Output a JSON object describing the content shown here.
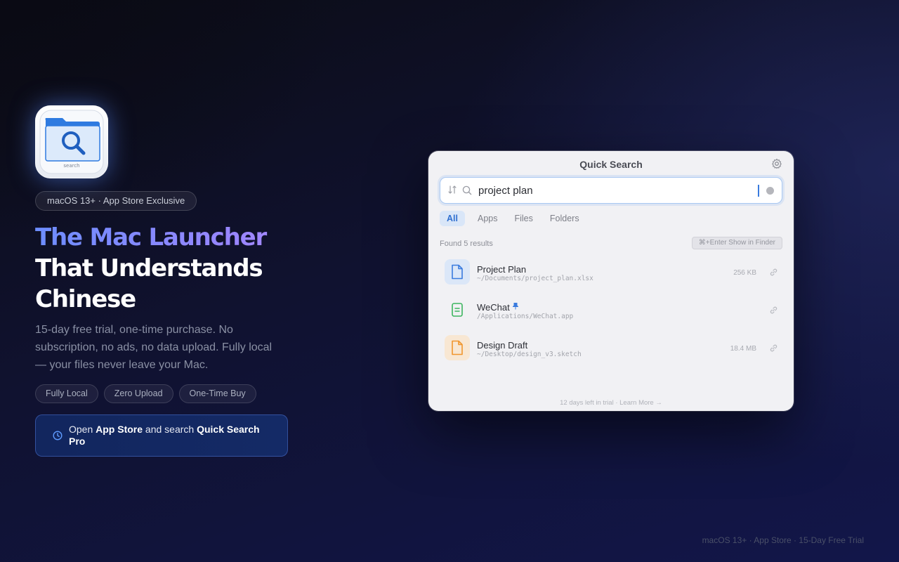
{
  "hero": {
    "app_icon_caption": "search",
    "badge": "macOS 13+ · App Store Exclusive",
    "headline_accent": "The Mac Launcher",
    "headline_line2": "That Understands",
    "headline_line3": "Chinese",
    "subtitle": "15-day free trial, one-time purchase. No subscription, no ads, no data upload. Fully local — your files never leave your Mac.",
    "tags": [
      "Fully Local",
      "Zero Upload",
      "One-Time Buy"
    ],
    "cta": {
      "prefix": "Open ",
      "store": "App Store",
      "middle": " and search ",
      "app_name": "Quick Search Pro"
    },
    "footer": "macOS 13+ · App Store · 15-Day Free Trial"
  },
  "window": {
    "title": "Quick Search",
    "search": {
      "value": "project plan",
      "placeholder": ""
    },
    "tabs": [
      {
        "label": "All",
        "active": true
      },
      {
        "label": "Apps",
        "active": false
      },
      {
        "label": "Files",
        "active": false
      },
      {
        "label": "Folders",
        "active": false
      }
    ],
    "result_count": "Found 5 results",
    "shortcut_hint": "⌘+Enter Show in Finder",
    "results": [
      {
        "name": "Project Plan",
        "path": "~/Documents/project_plan.xlsx",
        "size": "256 KB",
        "icon": "document-icon",
        "color": "#3a7bde"
      },
      {
        "name": "WeChat",
        "path": "/Applications/WeChat.app",
        "size": "",
        "icon": "app-icon",
        "color": "#3cb55e",
        "pinned": true
      },
      {
        "name": "Design Draft",
        "path": "~/Desktop/design_v3.sketch",
        "size": "18.4 MB",
        "icon": "document-icon",
        "color": "#f0962e"
      }
    ],
    "trial_note": "12 days left in trial · Learn More →"
  },
  "colors": {
    "accent": "#3a7bde",
    "headline_gradient_start": "#6d8dff",
    "headline_gradient_end": "#b391ff",
    "background": "#101230"
  }
}
